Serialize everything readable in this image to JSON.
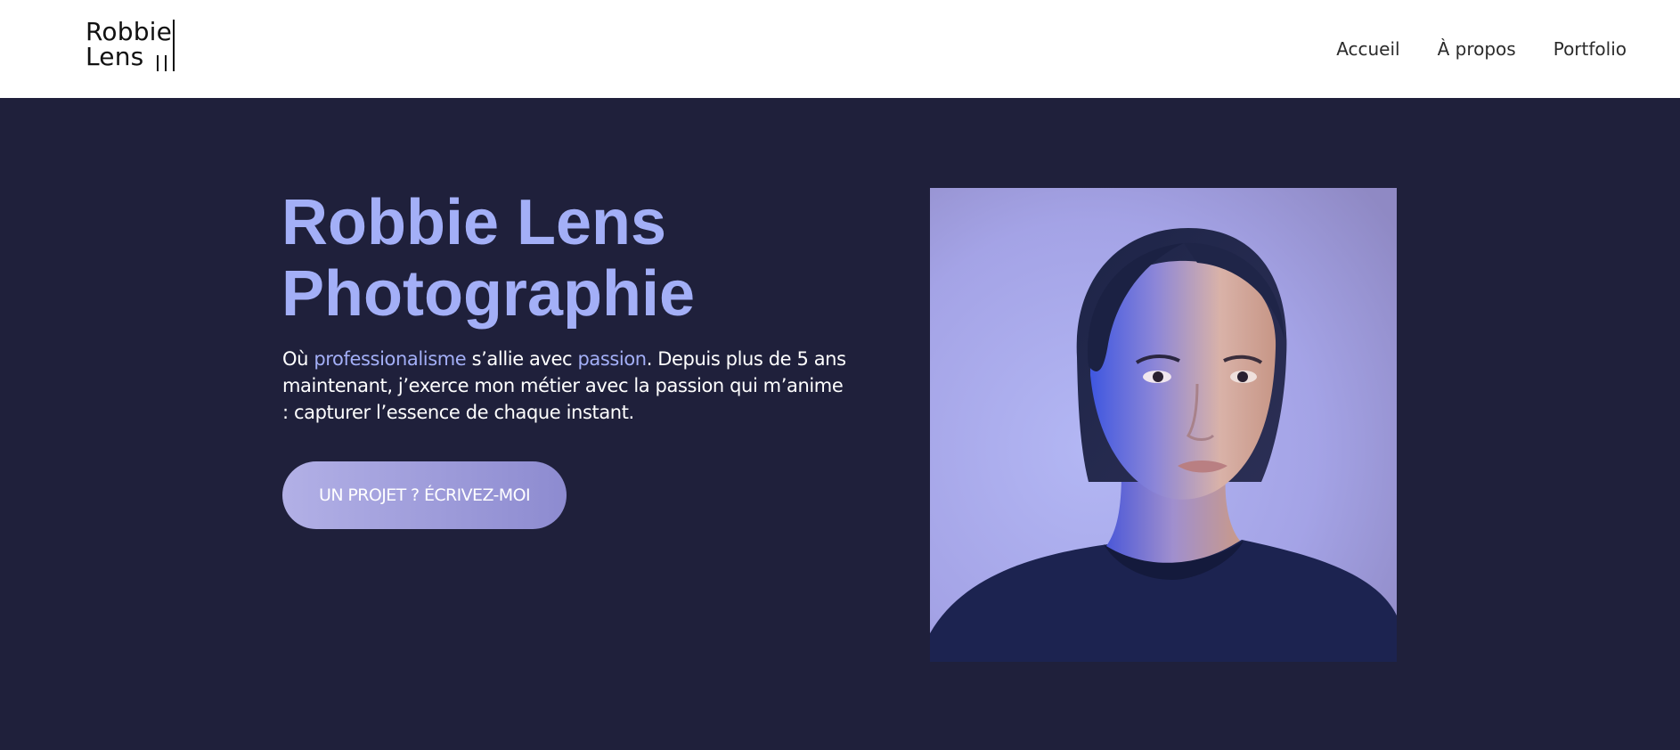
{
  "header": {
    "logo": {
      "line1": "Robbie",
      "line2": "Lens"
    },
    "nav": [
      {
        "label": "Accueil"
      },
      {
        "label": "À propos"
      },
      {
        "label": "Portfolio"
      }
    ]
  },
  "hero": {
    "title_line1": "Robbie Lens",
    "title_line2": "Photographie",
    "text": {
      "part1": "Où ",
      "highlight1": "professionalisme",
      "part2": " s’allie avec ",
      "highlight2": "passion",
      "part3": ". Depuis plus de 5 ans maintenant, j’exerce mon métier avec la passion qui m’anime : capturer l’essence de chaque instant."
    },
    "cta_label": "UN PROJET ? ÉCRIVEZ-MOI"
  },
  "colors": {
    "page_bg": "#1f203b",
    "header_bg": "#ffffff",
    "accent": "#a3aff7",
    "button_start": "#b2b0e6",
    "button_end": "#8d8bd0"
  }
}
